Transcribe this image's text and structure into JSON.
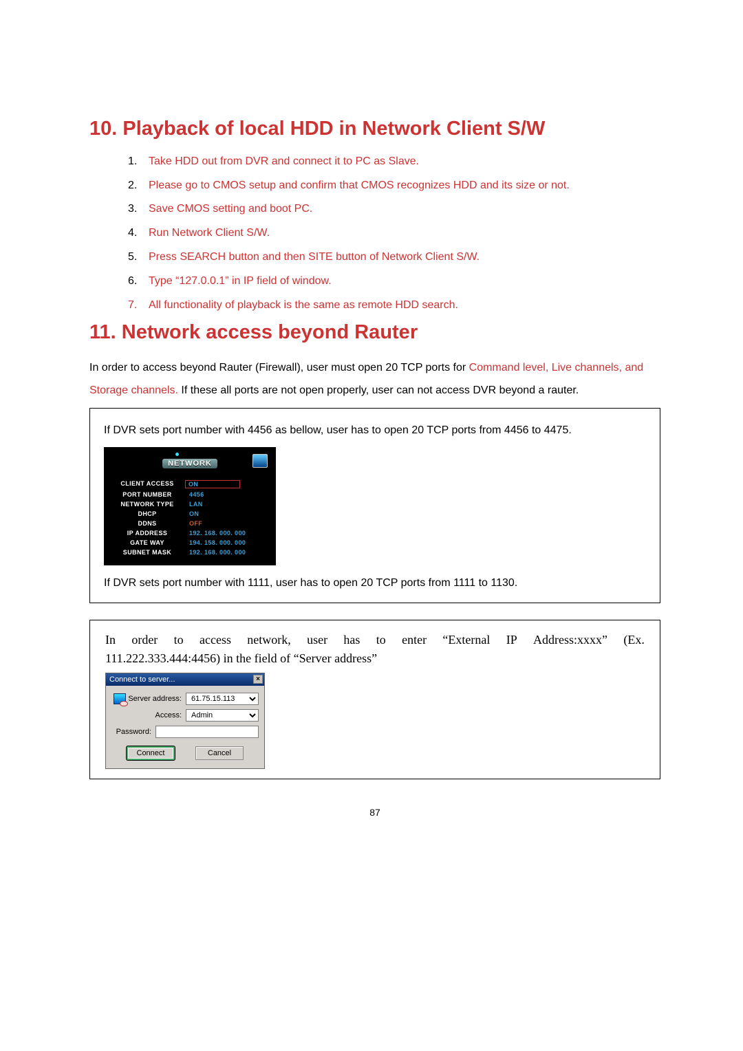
{
  "section10": {
    "title": "10. Playback of local HDD in Network Client S/W",
    "steps": [
      "Take HDD out from DVR and connect it to PC as Slave.",
      "Please go to CMOS setup and confirm that CMOS recognizes HDD and its size or not.",
      "Save CMOS setting and boot PC.",
      "Run Network Client S/W.",
      "Press SEARCH button and then SITE button of Network Client S/W.",
      "Type “127.0.0.1” in IP field of window.",
      "All functionality of playback is the same as remote HDD search."
    ]
  },
  "section11": {
    "title": "11. Network access beyond Rauter",
    "intro_black_1": "In order to access beyond Rauter (Firewall), user must open 20 TCP ports for ",
    "intro_red": "Command level, Live channels, and Storage channels.",
    "intro_black_2": " If these all ports are not open properly, user can not access DVR beyond a rauter."
  },
  "box1": {
    "top_text": "If DVR sets port number with 4456 as bellow, user has to open 20 TCP ports from 4456 to 4475.",
    "dvr": {
      "badge": "NETWORK",
      "rows": [
        {
          "label": "CLIENT ACCESS",
          "value": "ON",
          "style": "onbox"
        },
        {
          "label": "PORT NUMBER",
          "value": "4456",
          "style": "blue"
        },
        {
          "label": "NETWORK TYPE",
          "value": "LAN",
          "style": "blue"
        },
        {
          "label": "DHCP",
          "value": "ON",
          "style": "blue"
        },
        {
          "label": "DDNS",
          "value": "OFF",
          "style": "off"
        },
        {
          "label": "IP ADDRESS",
          "value": "192. 168. 000. 000",
          "style": "blue"
        },
        {
          "label": "GATE WAY",
          "value": "194. 158. 000. 000",
          "style": "blue"
        },
        {
          "label": "SUBNET MASK",
          "value": "192. 168. 000. 000",
          "style": "blue"
        }
      ]
    },
    "bottom_text": "If DVR sets port number with 1111, user has to open 20 TCP ports from 1111 to 1130."
  },
  "box2": {
    "justified_words": [
      "In",
      "order",
      "to",
      "access",
      "network,",
      "user",
      "has",
      "to",
      "enter",
      "“External",
      "IP",
      "Address:xxxx”",
      "(Ex."
    ],
    "line2": "111.222.333.444:4456) in the field of “Server address”",
    "dialog": {
      "title": "Connect to server...",
      "close": "×",
      "server_address_label": "Server address:",
      "server_address_value": "61.75.15.113",
      "access_label": "Access:",
      "access_value": "Admin",
      "password_label": "Password:",
      "password_value": "",
      "connect": "Connect",
      "cancel": "Cancel"
    }
  },
  "pagenum": "87"
}
